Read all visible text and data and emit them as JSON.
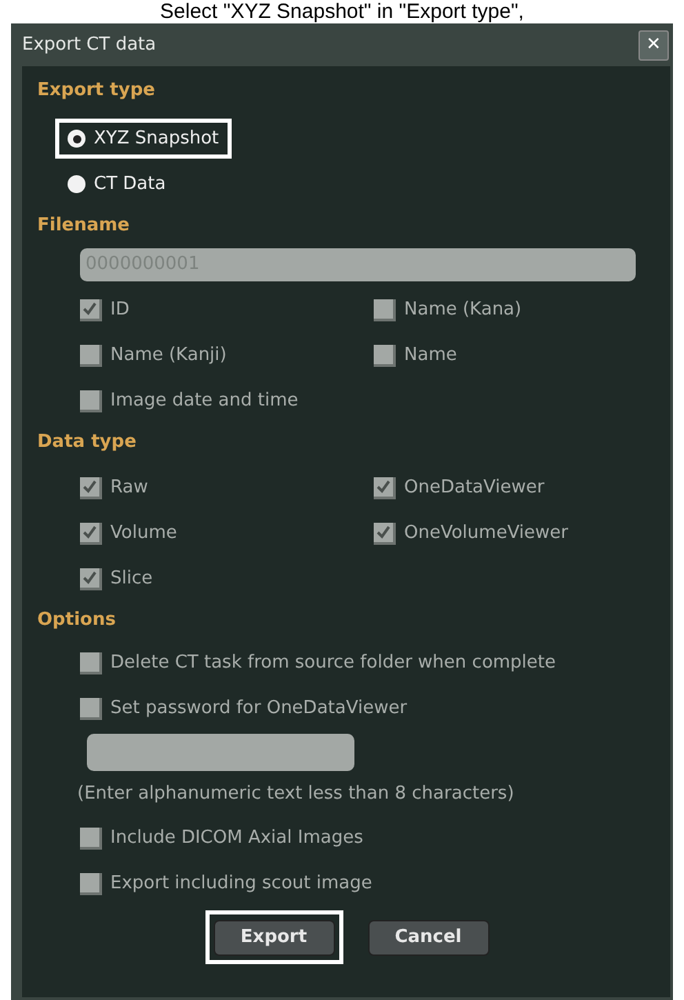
{
  "caption": "Select \"XYZ Snapshot\" in \"Export type\",",
  "window": {
    "title": "Export CT data",
    "close": "✕"
  },
  "export_type": {
    "heading": "Export type",
    "options": [
      {
        "label": "XYZ Snapshot",
        "selected": true,
        "highlighted": true
      },
      {
        "label": "CT Data",
        "selected": false,
        "highlighted": false
      }
    ]
  },
  "filename": {
    "heading": "Filename",
    "value": "0000000001",
    "checkboxes": [
      {
        "label": "ID",
        "checked": true
      },
      {
        "label": "Name (Kana)",
        "checked": false
      },
      {
        "label": "Name (Kanji)",
        "checked": false
      },
      {
        "label": "Name",
        "checked": false
      },
      {
        "label": "Image date and time",
        "checked": false
      }
    ]
  },
  "data_type": {
    "heading": "Data type",
    "checkboxes": [
      {
        "label": "Raw",
        "checked": true
      },
      {
        "label": "OneDataViewer",
        "checked": true
      },
      {
        "label": "Volume",
        "checked": true
      },
      {
        "label": "OneVolumeViewer",
        "checked": true
      },
      {
        "label": "Slice",
        "checked": true
      }
    ]
  },
  "options": {
    "heading": "Options",
    "items": [
      {
        "kind": "checkbox",
        "label": "Delete CT task from source folder when complete",
        "checked": false
      },
      {
        "kind": "checkbox",
        "label": "Set password for OneDataViewer",
        "checked": false
      },
      {
        "kind": "field"
      },
      {
        "kind": "hint",
        "label": "(Enter alphanumeric text less than 8 characters)"
      },
      {
        "kind": "checkbox",
        "label": "Include DICOM Axial Images",
        "checked": false
      },
      {
        "kind": "checkbox",
        "label": "Export including scout image",
        "checked": false
      }
    ]
  },
  "buttons": [
    {
      "label": "Export",
      "highlighted": true
    },
    {
      "label": "Cancel",
      "highlighted": false
    }
  ]
}
